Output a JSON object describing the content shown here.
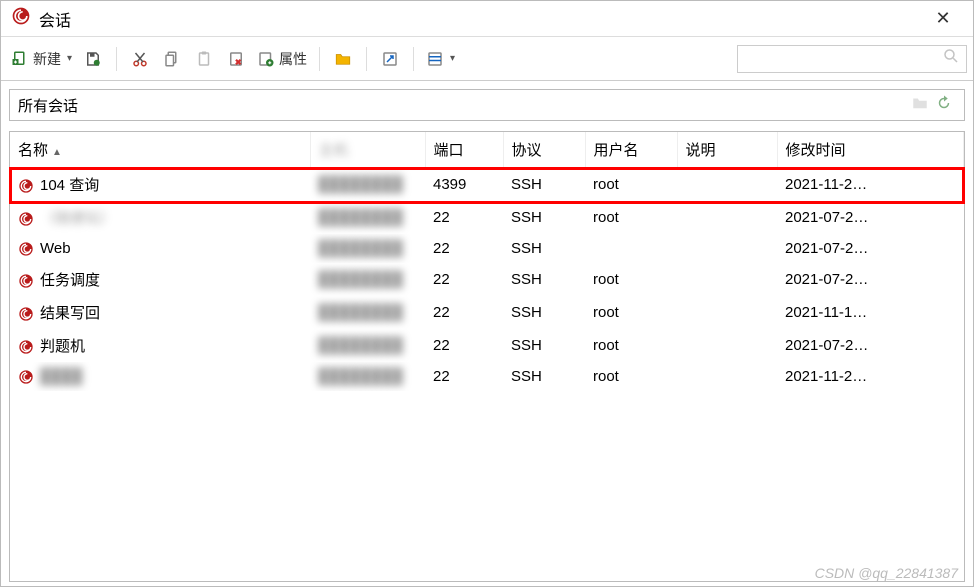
{
  "window": {
    "title": "会话"
  },
  "toolbar": {
    "new_label": "新建",
    "props_label": "属性"
  },
  "pathbar": {
    "text": "所有会话"
  },
  "columns": {
    "name": "名称",
    "host": "主机",
    "port": "端口",
    "proto": "协议",
    "user": "用户名",
    "desc": "说明",
    "mtime": "修改时间"
  },
  "rows": [
    {
      "name": "104 查询",
      "host": "████████",
      "port": "4399",
      "proto": "SSH",
      "user": "root",
      "desc": "",
      "mtime": "2021-11-2…"
    },
    {
      "name": "（随便玩）",
      "host": "████████",
      "port": "22",
      "proto": "SSH",
      "user": "root",
      "desc": "",
      "mtime": "2021-07-2…"
    },
    {
      "name": "Web",
      "host": "████████",
      "port": "22",
      "proto": "SSH",
      "user": "",
      "desc": "",
      "mtime": "2021-07-2…"
    },
    {
      "name": "任务调度",
      "host": "████████",
      "port": "22",
      "proto": "SSH",
      "user": "root",
      "desc": "",
      "mtime": "2021-07-2…"
    },
    {
      "name": "结果写回",
      "host": "████████",
      "port": "22",
      "proto": "SSH",
      "user": "root",
      "desc": "",
      "mtime": "2021-11-1…"
    },
    {
      "name": "判题机",
      "host": "████████",
      "port": "22",
      "proto": "SSH",
      "user": "root",
      "desc": "",
      "mtime": "2021-07-2…"
    },
    {
      "name": "████",
      "host": "████████",
      "port": "22",
      "proto": "SSH",
      "user": "root",
      "desc": "",
      "mtime": "2021-11-2…"
    }
  ],
  "watermark": "CSDN @qq_22841387"
}
